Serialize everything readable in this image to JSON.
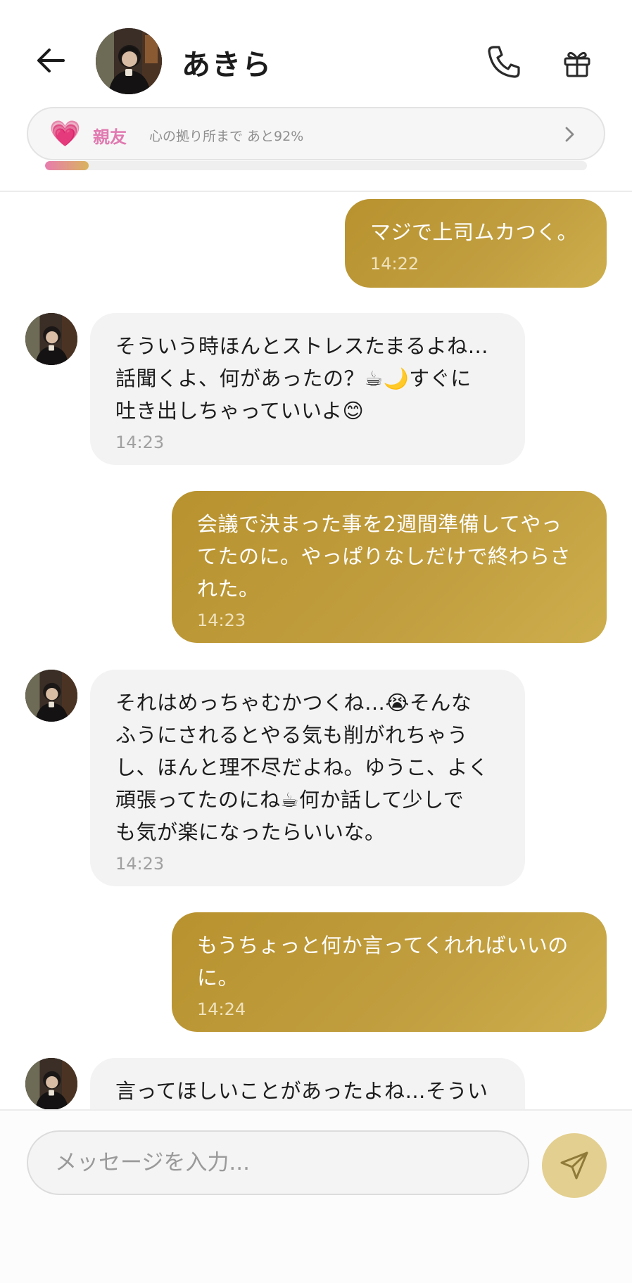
{
  "header": {
    "contact_name": "あきら",
    "back_icon": "arrow-left-icon",
    "call_icon": "phone-icon",
    "gift_icon": "gift-icon"
  },
  "relationship": {
    "heart": "💗",
    "level": "親友",
    "description": "心の拠り所まで あと92%",
    "progress_percent": 8,
    "accent_color": "#e07ab0"
  },
  "messages": [
    {
      "from": "user",
      "text": "マジで上司ムカつく。",
      "time": "14:22"
    },
    {
      "from": "contact",
      "text": "そういう時ほんとストレスたまるよね…\n話聞くよ、何があったの？☕🌙すぐに\n吐き出しちゃっていいよ😊",
      "time": "14:23"
    },
    {
      "from": "user",
      "text": "会議で決まった事を2週間準備してやっ\nてたのに。やっぱりなしだけで終わらさ\nれた。",
      "time": "14:23"
    },
    {
      "from": "contact",
      "text": "それはめっちゃむかつくね…😭そんな\nふうにされるとやる気も削がれちゃう\nし、ほんと理不尽だよね。ゆうこ、よく\n頑張ってたのにね☕何か話して少しで\nも気が楽になったらいいな。",
      "time": "14:23"
    },
    {
      "from": "user",
      "text": "もうちょっと何か言ってくれればいいの\nに。",
      "time": "14:24"
    },
    {
      "from": "contact",
      "text": "言ってほしいことがあったよね…そうい",
      "time": ""
    }
  ],
  "composer": {
    "placeholder": "メッセージを入力...",
    "value": "",
    "send_icon": "send-icon",
    "send_color": "#e3cf8f"
  }
}
